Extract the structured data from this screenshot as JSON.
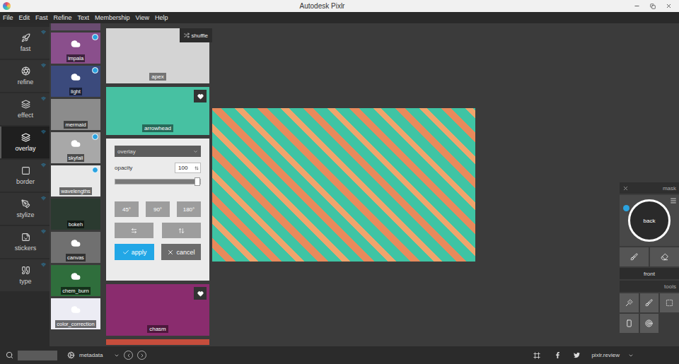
{
  "window": {
    "title": "Autodesk Pixlr"
  },
  "menu": [
    "File",
    "Edit",
    "Fast",
    "Refine",
    "Text",
    "Membership",
    "View",
    "Help"
  ],
  "tools": [
    {
      "label": "fast",
      "selected": false
    },
    {
      "label": "refine",
      "selected": false
    },
    {
      "label": "effect",
      "selected": false
    },
    {
      "label": "overlay",
      "selected": true
    },
    {
      "label": "border",
      "selected": false
    },
    {
      "label": "stylize",
      "selected": false
    },
    {
      "label": "stickers",
      "selected": false
    },
    {
      "label": "type",
      "selected": false
    }
  ],
  "thumbnails": [
    {
      "label": "impala",
      "download": true,
      "badge": true,
      "color": "#8a4f8c"
    },
    {
      "label": "light",
      "download": true,
      "badge": true,
      "color": "#3b4a7c"
    },
    {
      "label": "mermaid",
      "download": false,
      "badge": false,
      "color": "#8c8c8c"
    },
    {
      "label": "skyfall",
      "download": true,
      "badge": true,
      "color": "#a8a8a8"
    },
    {
      "label": "wavelengths",
      "download": false,
      "badge": true,
      "color": "#e8e8e8"
    },
    {
      "label": "bokeh",
      "download": false,
      "badge": false,
      "color": "#2b3a30"
    },
    {
      "label": "canvas",
      "download": true,
      "badge": false,
      "color": "#707070"
    },
    {
      "label": "chem_burn",
      "download": true,
      "badge": false,
      "color": "#2f6e3c"
    },
    {
      "label": "color_correction",
      "download": true,
      "badge": false,
      "color": "#ececf4"
    }
  ],
  "shuffle": {
    "label": "shuffle"
  },
  "overlays": [
    {
      "label": "apex",
      "favorite": true,
      "expanded": false,
      "color": "#d4d4d4"
    },
    {
      "label": "arrowhead",
      "favorite": true,
      "expanded": true,
      "color": "#47c1a2"
    },
    {
      "label": "chasm",
      "favorite": true,
      "expanded": false,
      "color": "#8a2c6e"
    }
  ],
  "settings": {
    "blend_mode": "overlay",
    "opacity_label": "opacity",
    "opacity": "100",
    "level": 1,
    "rotations": [
      "45°",
      "90°",
      "180°"
    ],
    "apply": "apply",
    "cancel": "cancel"
  },
  "mask": {
    "title": "mask",
    "back": "back",
    "front": "front"
  },
  "tools_panel": {
    "title": "tools"
  },
  "status_bar": {
    "metadata": "metadata",
    "link": "pixlr.review"
  }
}
